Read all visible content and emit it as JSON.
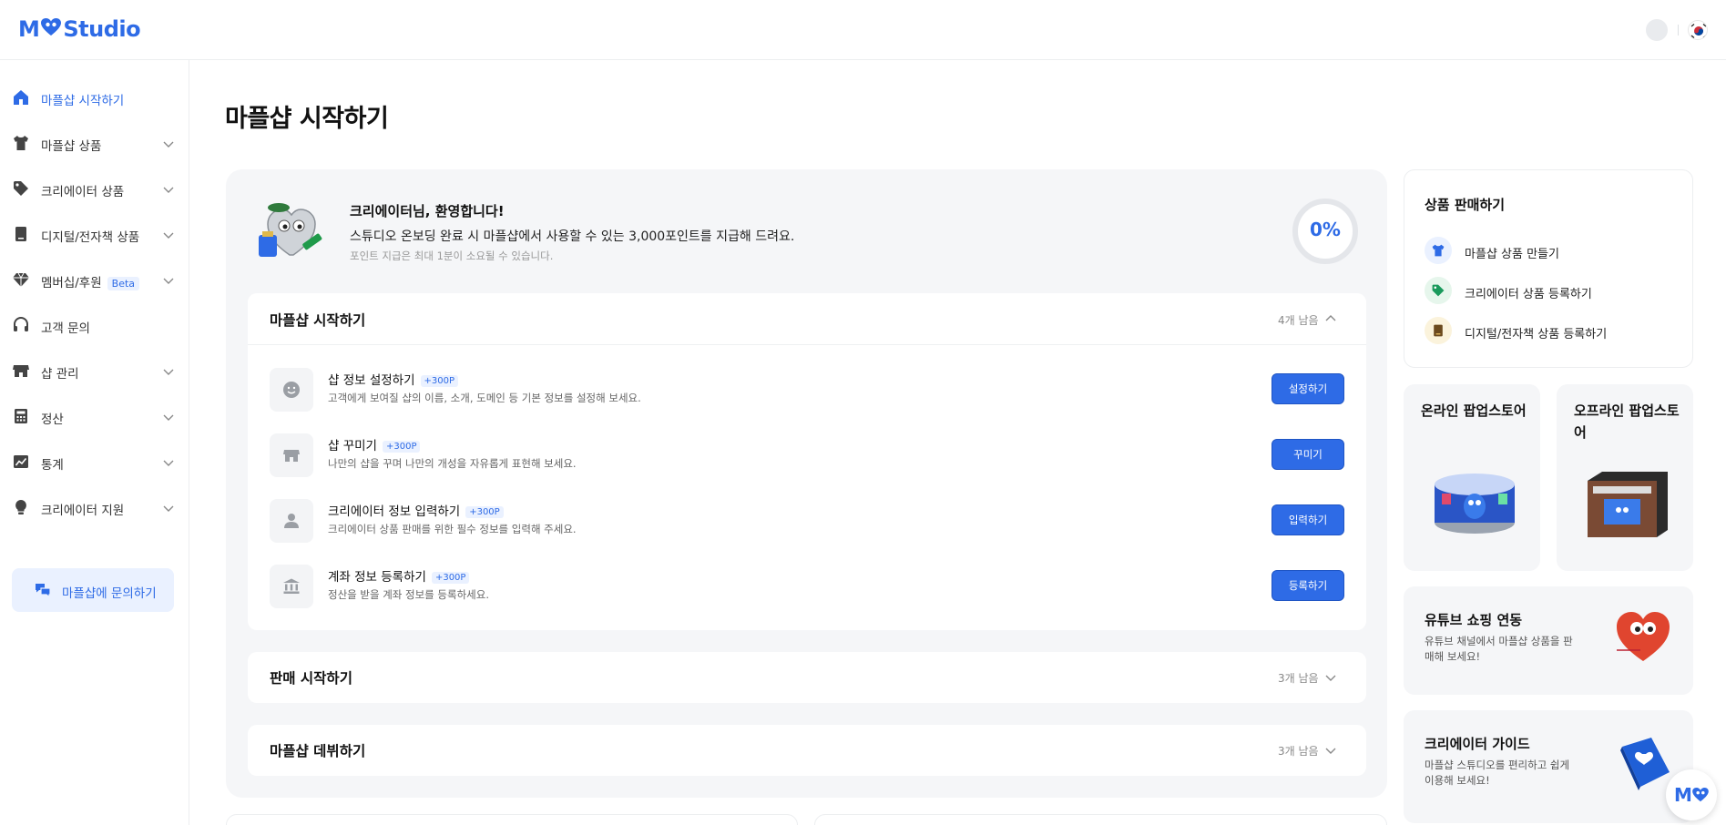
{
  "app": {
    "logo_text_left": "M",
    "logo_text_right": "Studio"
  },
  "sidebar": {
    "items": [
      {
        "label": "마플샵 시작하기",
        "icon": "home-icon",
        "active": true
      },
      {
        "label": "마플샵 상품",
        "icon": "tshirt-icon"
      },
      {
        "label": "크리에이터 상품",
        "icon": "tag-icon"
      },
      {
        "label": "디지털/전자책 상품",
        "icon": "ebook-icon"
      },
      {
        "label": "멤버십/후원",
        "icon": "diamond-icon",
        "badge": "Beta"
      },
      {
        "label": "고객 문의",
        "icon": "headset-icon"
      },
      {
        "label": "샵 관리",
        "icon": "store-icon"
      },
      {
        "label": "정산",
        "icon": "calculator-icon"
      },
      {
        "label": "통계",
        "icon": "chart-icon"
      },
      {
        "label": "크리에이터 지원",
        "icon": "bulb-icon"
      }
    ],
    "inquiry_label": "마플샵에 문의하기"
  },
  "main": {
    "page_title": "마플샵 시작하기",
    "welcome": {
      "title": "크리에이터님, 환영합니다!",
      "desc": "스튜디오 온보딩 완료 시 마플샵에서 사용할 수 있는 3,000포인트를 지급해 드려요.",
      "note": "포인트 지급은 최대 1분이 소요될 수 있습니다.",
      "progress": "0%",
      "progress_value": 0
    },
    "sections": [
      {
        "title": "마플샵 시작하기",
        "remaining": "4개 남음",
        "expanded": true,
        "tasks": [
          {
            "title": "샵 정보 설정하기",
            "badge": "+300P",
            "desc": "고객에게 보여질 샵의 이름, 소개, 도메인 등 기본 정보를 설정해 보세요.",
            "button": "설정하기",
            "icon": "smile-icon"
          },
          {
            "title": "샵 꾸미기",
            "badge": "+300P",
            "desc": "나만의 샵을 꾸며 나만의 개성을 자유롭게 표현해 보세요.",
            "button": "꾸미기",
            "icon": "store-icon"
          },
          {
            "title": "크리에이터 정보 입력하기",
            "badge": "+300P",
            "desc": "크리에이터 상품 판매를 위한 필수 정보를 입력해 주세요.",
            "button": "입력하기",
            "icon": "person-icon"
          },
          {
            "title": "계좌 정보 등록하기",
            "badge": "+300P",
            "desc": "정산을 받을 계좌 정보를 등록하세요.",
            "button": "등록하기",
            "icon": "bank-icon"
          }
        ]
      },
      {
        "title": "판매 시작하기",
        "remaining": "3개 남음",
        "expanded": false
      },
      {
        "title": "마플샵 데뷔하기",
        "remaining": "3개 남음",
        "expanded": false
      }
    ]
  },
  "right": {
    "sell": {
      "title": "상품 판매하기",
      "items": [
        {
          "label": "마플샵 상품 만들기",
          "icon": "tshirt-icon",
          "color": "#2e6be6"
        },
        {
          "label": "크리에이터 상품 등록하기",
          "icon": "tag-icon",
          "color": "#1a9a5c"
        },
        {
          "label": "디지털/전자책 상품 등록하기",
          "icon": "ebook-icon",
          "color": "#6b4a1e"
        }
      ]
    },
    "popup": [
      {
        "title": "온라인 팝업스토어"
      },
      {
        "title": "오프라인 팝업스토어"
      }
    ],
    "youtube": {
      "title": "유튜브 쇼핑 연동",
      "desc": "유튜브 채널에서 마플샵 상품을 판매해 보세요!"
    },
    "guide": {
      "title": "크리에이터 가이드",
      "desc": "마플샵 스튜디오를 편리하고 쉽게 이용해 보세요!"
    },
    "fab_label": "M"
  },
  "colors": {
    "accent": "#2e6be6",
    "accent_light": "#eaf1ff",
    "panel": "#f5f6f8"
  }
}
